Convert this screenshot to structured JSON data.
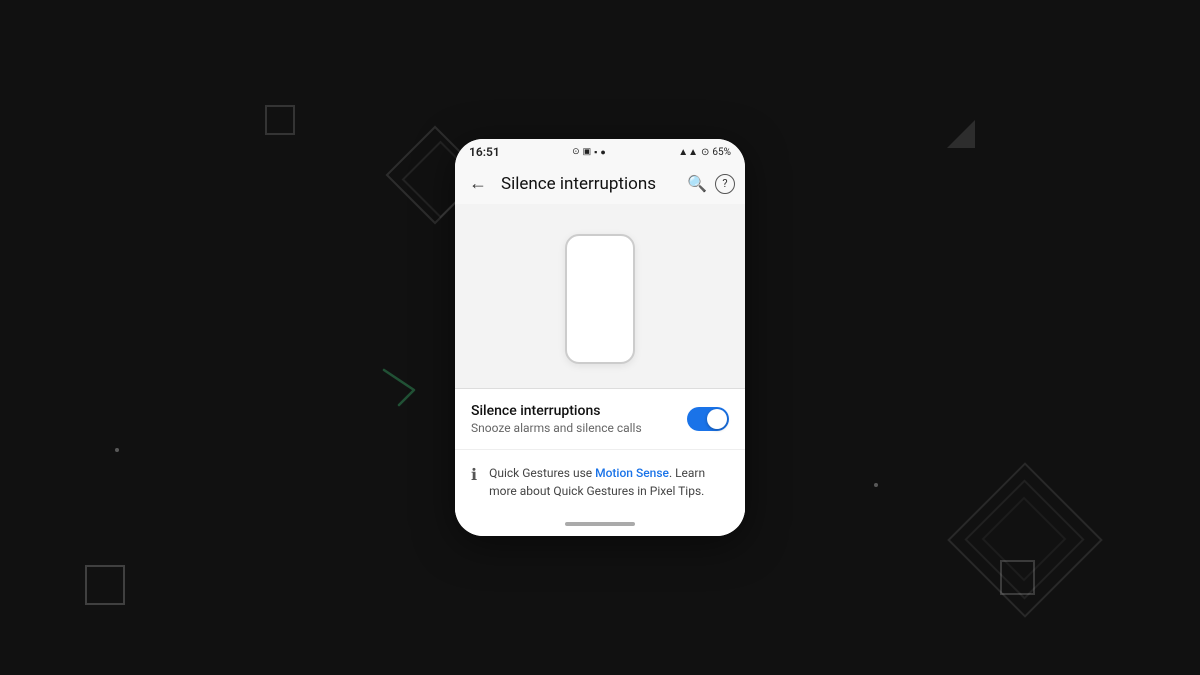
{
  "background": {
    "color": "#111"
  },
  "status_bar": {
    "time": "16:51",
    "battery": "65%",
    "icons": "● ▣ ▪ ▪ ●"
  },
  "app_bar": {
    "title": "Silence interruptions",
    "back_label": "←",
    "search_label": "⌕",
    "help_label": "?"
  },
  "phone_illustration": {
    "alt": "Phone gesture illustration"
  },
  "setting": {
    "title": "Silence interruptions",
    "subtitle": "Snooze alarms and silence calls",
    "toggle_enabled": true
  },
  "info": {
    "text_prefix": "Quick Gestures use ",
    "link_text": "Motion Sense",
    "text_suffix": ". Learn more about Quick Gestures in Pixel Tips."
  },
  "nav_indicator": {
    "label": "home indicator"
  }
}
